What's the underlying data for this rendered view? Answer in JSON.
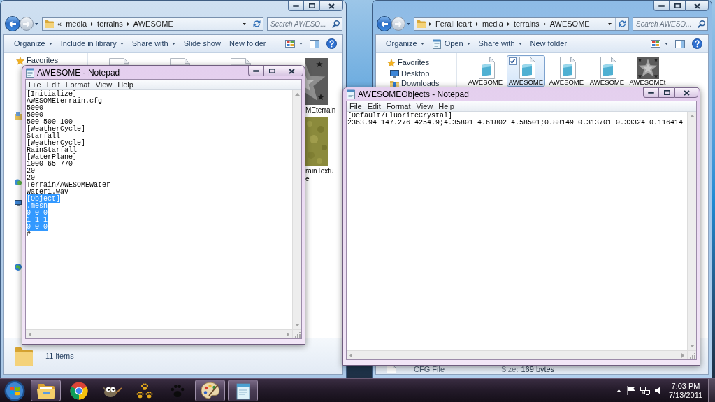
{
  "explorers": [
    {
      "path_overflow": "«",
      "path": [
        "media",
        "terrains",
        "AWESOME"
      ],
      "forward_disabled": true,
      "search": {
        "placeholder": "Search AWESO..."
      },
      "toolbar": [
        {
          "label": "Organize",
          "kind": "dropdown"
        },
        {
          "label": "Include in library",
          "kind": "dropdown"
        },
        {
          "label": "Share with",
          "kind": "dropdown"
        },
        {
          "label": "Slide show",
          "kind": "button"
        },
        {
          "label": "New folder",
          "kind": "button"
        }
      ],
      "nav": [
        {
          "kind": "favorites",
          "label": "Favorites"
        },
        {
          "kind": "libraries"
        },
        {
          "kind": "homegroup"
        },
        {
          "kind": "computer"
        },
        {
          "kind": "network"
        }
      ],
      "files": [
        {
          "kind": "document"
        },
        {
          "kind": "document"
        },
        {
          "kind": "document"
        },
        {
          "kind": "star-image",
          "label_lines": [
            "MEterrain"
          ]
        },
        {
          "kind": "texture-image",
          "label_lines": [
            "rainTextu",
            "e"
          ]
        }
      ],
      "details": {
        "kind": "folder",
        "text": "11 items"
      }
    },
    {
      "path": [
        "FeralHeart",
        "media",
        "terrains",
        "AWESOME"
      ],
      "forward_disabled": true,
      "search": {
        "placeholder": "Search AWESO..."
      },
      "toolbar": [
        {
          "label": "Organize",
          "kind": "dropdown"
        },
        {
          "label": "Open",
          "kind": "app-dropdown"
        },
        {
          "label": "Share with",
          "kind": "dropdown"
        },
        {
          "label": "New folder",
          "kind": "button"
        }
      ],
      "nav": [
        {
          "kind": "favorites",
          "label": "Favorites"
        },
        {
          "kind": "desktop",
          "label": "Desktop"
        },
        {
          "kind": "downloads",
          "label": "Downloads"
        }
      ],
      "files": [
        {
          "kind": "document",
          "selected": false,
          "label_lines": [
            "AWESOME"
          ]
        },
        {
          "kind": "document",
          "selected": true,
          "label_lines": [
            "AWESOME"
          ]
        },
        {
          "kind": "document",
          "selected": false,
          "label_lines": [
            "AWESOME"
          ]
        },
        {
          "kind": "document",
          "selected": false,
          "label_lines": [
            "AWESOME"
          ]
        },
        {
          "kind": "star-image",
          "selected": false,
          "label_lines": [
            "AWESOMEt"
          ]
        }
      ],
      "details": {
        "kind": "file",
        "type": "CFG File",
        "size_label": "Size:",
        "size": "169 bytes"
      }
    }
  ],
  "notepads": [
    {
      "title": "AWESOME - Notepad",
      "menu": [
        "File",
        "Edit",
        "Format",
        "View",
        "Help"
      ],
      "lines": [
        {
          "text": "[Initialize]",
          "selected": false
        },
        {
          "text": "AWESOMEterrain.cfg",
          "selected": false
        },
        {
          "text": "5000",
          "selected": false
        },
        {
          "text": "5000",
          "selected": false
        },
        {
          "text": "500 500 100",
          "selected": false
        },
        {
          "text": "[WeatherCycle]",
          "selected": false
        },
        {
          "text": "Starfall",
          "selected": false
        },
        {
          "text": "[WeatherCycle]",
          "selected": false
        },
        {
          "text": "RainStarfall",
          "selected": false
        },
        {
          "text": "[WaterPlane]",
          "selected": false
        },
        {
          "text": "1000 65 770",
          "selected": false
        },
        {
          "text": "20",
          "selected": false
        },
        {
          "text": "20",
          "selected": false
        },
        {
          "text": "Terrain/AWESOMEwater",
          "selected": false
        },
        {
          "text": "water1.wav",
          "selected": false
        },
        {
          "text": "[Object]",
          "selected": true
        },
        {
          "text": ".mesh",
          "selected": true
        },
        {
          "text": "0 0 0",
          "selected": true
        },
        {
          "text": "1 1 1",
          "selected": true
        },
        {
          "text": "0 0 0",
          "selected": true
        },
        {
          "text": "#",
          "selected": false
        }
      ]
    },
    {
      "title": "AWESOMEObjects - Notepad",
      "menu": [
        "File",
        "Edit",
        "Format",
        "View",
        "Help"
      ],
      "lines": [
        {
          "text": "[Default/FluoriteCrystal]",
          "selected": false
        },
        {
          "text": "2363.94 147.276 4254.9;4.35801 4.61802 4.58501;0.88149 0.313701 0.33324 0.116414",
          "selected": false
        }
      ]
    }
  ],
  "taskbar": {
    "apps": [
      {
        "kind": "explorer",
        "running": true
      },
      {
        "kind": "browser",
        "running": false
      },
      {
        "kind": "image-editor",
        "running": false
      },
      {
        "kind": "paws",
        "running": false
      },
      {
        "kind": "paw",
        "running": false
      },
      {
        "kind": "paint",
        "running": true
      },
      {
        "kind": "notepad",
        "running": true
      }
    ],
    "clock": {
      "time": "7:03 PM",
      "date": "7/13/2011"
    }
  }
}
